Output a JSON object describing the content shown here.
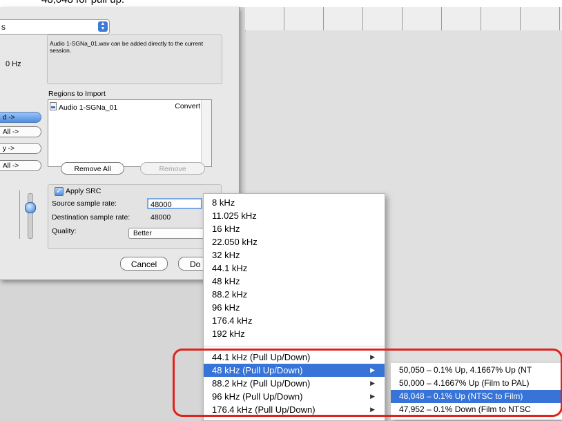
{
  "caption": "48,048 for pull up.",
  "dialog": {
    "top_popup_value": "s",
    "info_text": "Audio 1-SGNa_01.wav can be added directly to the current session.",
    "hz_label": "0 Hz",
    "regions_label": "Regions to Import",
    "region": {
      "name": "Audio 1-SGNa_01",
      "action": "Convert"
    },
    "side_buttons": [
      "d ->",
      "All ->",
      "y ->",
      "All ->"
    ],
    "remove_all_label": "Remove All",
    "remove_label": "Remove",
    "apply_src_label": "Apply SRC",
    "source_rate_label": "Source sample rate:",
    "source_rate_value": "48000",
    "dest_rate_label": "Destination sample rate:",
    "dest_rate_value": "48000",
    "quality_label": "Quality:",
    "quality_value": "Better",
    "cancel_label": "Cancel",
    "done_label": "Do"
  },
  "menu": {
    "rates": [
      "8 kHz",
      "11.025 kHz",
      "16 kHz",
      "22.050 kHz",
      "32 kHz",
      "44.1 kHz",
      "48 kHz",
      "88.2 kHz",
      "96 kHz",
      "176.4 kHz",
      "192 kHz"
    ],
    "pull_items": [
      "44.1 kHz (Pull Up/Down)",
      "48 kHz (Pull Up/Down)",
      "88.2 kHz (Pull Up/Down)",
      "96 kHz (Pull Up/Down)",
      "176.4 kHz (Pull Up/Down)"
    ],
    "highlighted": "48 kHz (Pull Up/Down)"
  },
  "submenu": {
    "items": [
      "50,050 – 0.1% Up, 4.1667% Up (NT",
      "50,000 – 4.1667% Up (Film to PAL)",
      "48,048 – 0.1% Up (NTSC to Film)",
      "47,952 – 0.1% Down (Film to NTSC"
    ],
    "highlighted": "48,048 – 0.1% Up (NTSC to Film)"
  },
  "colors": {
    "highlight": "#3874d7",
    "annotation": "#e0221c"
  }
}
